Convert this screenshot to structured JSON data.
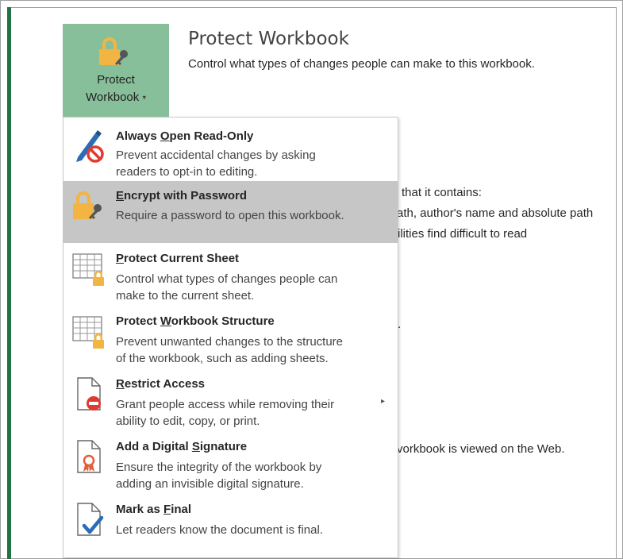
{
  "protect_button": {
    "line1": "Protect",
    "line2": "Workbook",
    "caret": "▾"
  },
  "section": {
    "title": "Protect Workbook",
    "description": "Control what types of changes people can make to this workbook."
  },
  "background_text": {
    "line1": "that it contains:",
    "line2": "ath, author's name and absolute path",
    "line3": "ilities find difficult to read",
    "line4": ".",
    "line5": "vorkbook is viewed on the Web."
  },
  "menu": {
    "items": [
      {
        "title_pre": "Always ",
        "title_u": "O",
        "title_post": "pen Read-Only",
        "desc1": "Prevent accidental changes by asking",
        "desc2": "readers to opt-in to editing.",
        "icon": "pencil-no-icon"
      },
      {
        "title_pre": "",
        "title_u": "E",
        "title_post": "ncrypt with Password",
        "desc1": "Require a password to open this workbook.",
        "desc2": "",
        "icon": "lock-key-icon"
      },
      {
        "title_pre": "",
        "title_u": "P",
        "title_post": "rotect Current Sheet",
        "desc1": "Control what types of changes people can",
        "desc2": "make to the current sheet.",
        "icon": "sheet-lock-icon"
      },
      {
        "title_pre": "Protect ",
        "title_u": "W",
        "title_post": "orkbook Structure",
        "desc1": "Prevent unwanted changes to the structure",
        "desc2": "of the workbook, such as adding sheets.",
        "icon": "workbook-lock-icon"
      },
      {
        "title_pre": "",
        "title_u": "R",
        "title_post": "estrict Access",
        "desc1": "Grant people access while removing their",
        "desc2": "ability to edit, copy, or print.",
        "icon": "document-restrict-icon",
        "submenu_arrow": "▸"
      },
      {
        "title_pre": "Add a Digital ",
        "title_u": "S",
        "title_post": "ignature",
        "desc1": "Ensure the integrity of the workbook by",
        "desc2": "adding an invisible digital signature.",
        "icon": "document-ribbon-icon"
      },
      {
        "title_pre": "Mark as ",
        "title_u": "F",
        "title_post": "inal",
        "desc1": "Let readers know the document is final.",
        "desc2": "",
        "icon": "document-check-icon"
      }
    ]
  },
  "colors": {
    "excel_green": "#217346",
    "button_bg": "#86bf9a",
    "highlight": "#c6c6c6",
    "lock_gold": "#f2b544",
    "no_red": "#e03b2f"
  }
}
